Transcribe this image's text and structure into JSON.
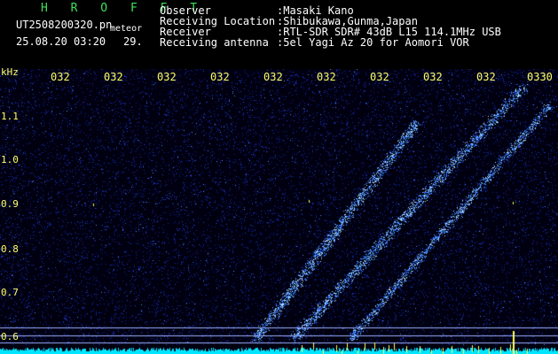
{
  "header": {
    "station": "H R O F F T",
    "filename": "UT2508200320.pn",
    "meteor_label": "meteor",
    "datetime": "25.08.20 03:20",
    "count": "29.",
    "observer_label": "Observer",
    "observer_value": ":Masaki Kano",
    "location_label": "Receiving Location",
    "location_value": ":Shibukawa,Gunma,Japan",
    "receiver_label": "Receiver",
    "receiver_value": ":RTL-SDR SDR# 43dB L15 114.1MHz USB",
    "antenna_label": "Receiving antenna",
    "antenna_value": ":5el Yagi Az 20 for Aomori VOR"
  },
  "axis": {
    "unit": "kHz",
    "y_ticks": [
      "1.1",
      "1.0",
      "0.9",
      "0.8",
      "0.7",
      "0.6"
    ],
    "x_ticks": [
      "032",
      "032",
      "032",
      "032",
      "032",
      "032",
      "032",
      "032",
      "032",
      "0330"
    ]
  },
  "colors": {
    "background": "#000000",
    "noise": "#1a2fb0",
    "signal": "#7fd0ff",
    "text": "#ffffff",
    "axis_text": "#ffff66",
    "title": "#3fe05a",
    "baseline": "#00e5ff"
  }
}
